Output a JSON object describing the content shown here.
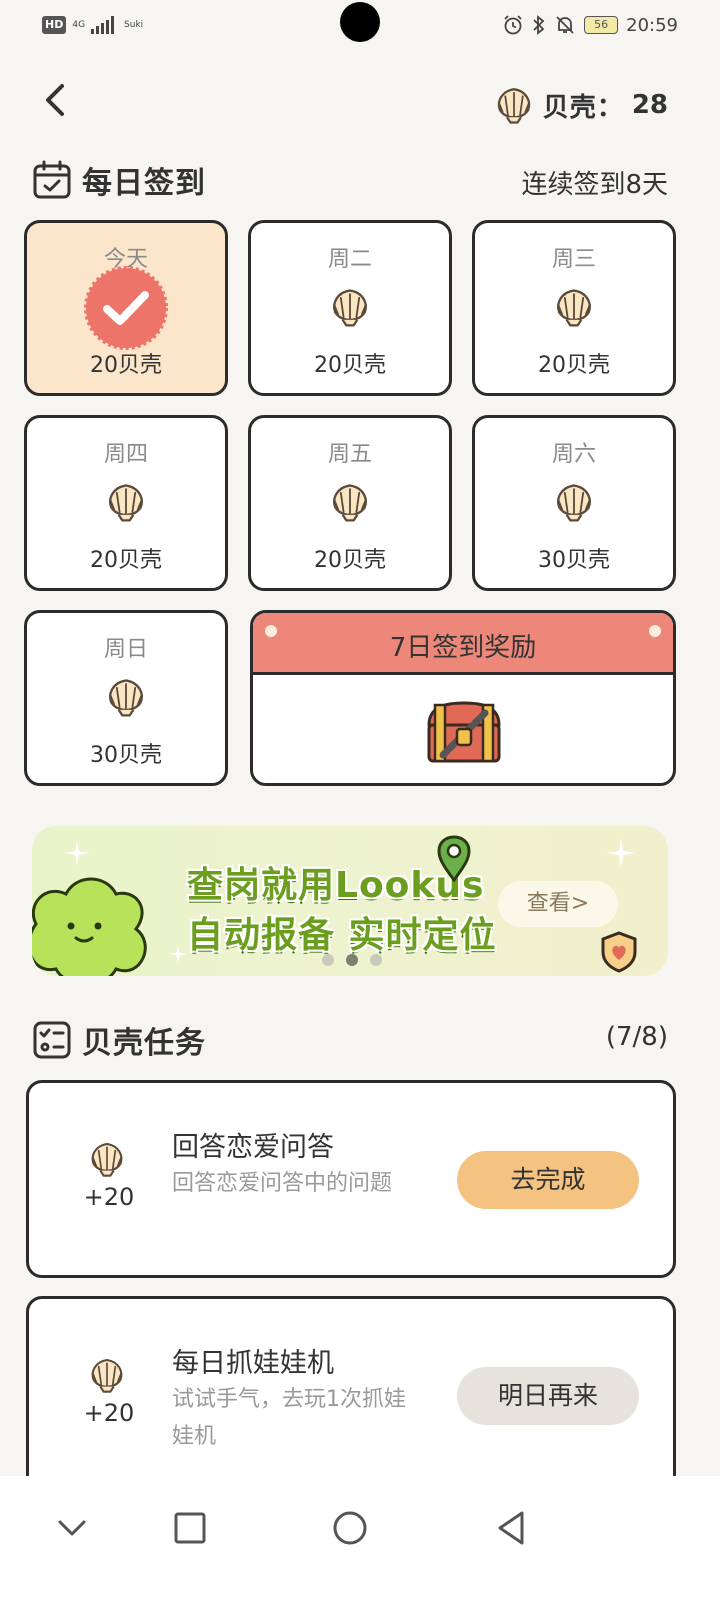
{
  "status_bar": {
    "hd": "HD",
    "network": "4G",
    "carrier": "Suki",
    "battery": "56",
    "time": "20:59"
  },
  "header": {
    "shell_label": "贝壳：",
    "shell_count": "28"
  },
  "checkin": {
    "title": "每日签到",
    "streak": "连续签到8天",
    "days": [
      {
        "label": "今天",
        "reward": "20贝壳",
        "checked": true
      },
      {
        "label": "周二",
        "reward": "20贝壳",
        "checked": false
      },
      {
        "label": "周三",
        "reward": "20贝壳",
        "checked": false
      },
      {
        "label": "周四",
        "reward": "20贝壳",
        "checked": false
      },
      {
        "label": "周五",
        "reward": "20贝壳",
        "checked": false
      },
      {
        "label": "周六",
        "reward": "30贝壳",
        "checked": false
      },
      {
        "label": "周日",
        "reward": "30贝壳",
        "checked": false
      }
    ],
    "bonus_title": "7日签到奖励"
  },
  "banner": {
    "line1": "查岗就用Lookus",
    "line2": "自动报备 实时定位",
    "button": "查看>",
    "active_dot": 1
  },
  "tasks": {
    "title": "贝壳任务",
    "progress": "(7/8)",
    "items": [
      {
        "points": "+20",
        "title": "回答恋爱问答",
        "desc": "回答恋爱问答中的问题",
        "button": "去完成",
        "state": "go"
      },
      {
        "points": "+20",
        "title": "每日抓娃娃机",
        "desc": "试试手气，去玩1次抓娃娃机",
        "button": "明日再来",
        "state": "done"
      }
    ]
  },
  "colors": {
    "today_bg": "#fbe6cc",
    "bonus_header": "#ec8779",
    "stamp": "#ec7468",
    "go_button": "#f4c382",
    "done_button": "#e6e3dc",
    "banner_text": "#6b9e1f"
  }
}
